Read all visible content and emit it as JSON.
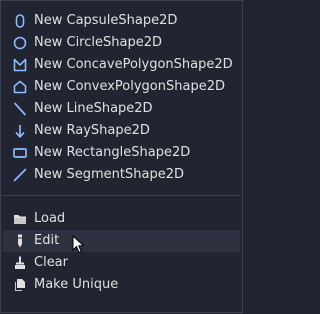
{
  "menu": {
    "shape_items": [
      {
        "label": "New CapsuleShape2D",
        "icon": "capsule-shape-icon"
      },
      {
        "label": "New CircleShape2D",
        "icon": "circle-shape-icon"
      },
      {
        "label": "New ConcavePolygonShape2D",
        "icon": "concave-polygon-icon"
      },
      {
        "label": "New ConvexPolygonShape2D",
        "icon": "convex-polygon-icon"
      },
      {
        "label": "New LineShape2D",
        "icon": "line-shape-icon"
      },
      {
        "label": "New RayShape2D",
        "icon": "ray-shape-icon"
      },
      {
        "label": "New RectangleShape2D",
        "icon": "rectangle-shape-icon"
      },
      {
        "label": "New SegmentShape2D",
        "icon": "segment-shape-icon"
      }
    ],
    "action_items": [
      {
        "label": "Load",
        "icon": "folder-icon"
      },
      {
        "label": "Edit",
        "icon": "edit-icon"
      },
      {
        "label": "Clear",
        "icon": "clear-icon"
      },
      {
        "label": "Make Unique",
        "icon": "duplicate-icon"
      }
    ],
    "colors": {
      "accent": "#8eb8ff",
      "background": "#202531",
      "hover": "#2d3240"
    }
  }
}
